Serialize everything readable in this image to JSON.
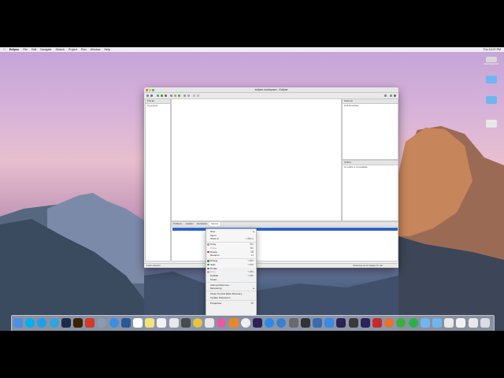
{
  "menubar": {
    "apple": "",
    "app": "Eclipse",
    "items": [
      "File",
      "Edit",
      "Navigate",
      "Search",
      "Project",
      "Run",
      "Window",
      "Help"
    ],
    "clock": "Thu 12:07 PM"
  },
  "desktop_icons": [
    {
      "label": "Macintosh HD",
      "color": "#d8d8d8"
    },
    {
      "label": "",
      "color": "#6fb6f0"
    },
    {
      "label": "",
      "color": "#6fb6f0"
    },
    {
      "label": "",
      "color": "#e8e8e8"
    }
  ],
  "window": {
    "title": "eclipse-workspace - Eclipse",
    "left_panel": {
      "tab": "Proj Ex",
      "body": "No projects"
    },
    "right_top": {
      "tab": "Task List",
      "body": "Find  All  Activate..."
    },
    "right_bottom": {
      "tab": "Outline",
      "body": "An outline is not available."
    },
    "bottom_tabs": [
      "Problems",
      "Javadoc",
      "Declaration",
      "Servers"
    ],
    "server_row": "Tomcat v8.5 Server at localhost",
    "status_left": "1 item selected",
    "status_right": "Retrieving server adapter for site"
  },
  "context_menu": {
    "items": [
      {
        "label": "New",
        "arrow": "▸",
        "shortcut": "",
        "icon": "",
        "disabled": false
      },
      {
        "label": "Open",
        "arrow": "",
        "shortcut": "",
        "icon": "",
        "disabled": false
      },
      {
        "label": "Show In",
        "arrow": "",
        "shortcut": "⌥⌘W ▸",
        "icon": "",
        "disabled": false
      },
      {
        "sep": true
      },
      {
        "label": "Copy",
        "arrow": "",
        "shortcut": "⌘C",
        "icon": "#9aa7b8",
        "disabled": false
      },
      {
        "label": "Paste",
        "arrow": "",
        "shortcut": "⌘V",
        "icon": "",
        "disabled": true
      },
      {
        "label": "Delete",
        "arrow": "",
        "shortcut": "⌫",
        "icon": "#d33",
        "disabled": false
      },
      {
        "label": "Rename",
        "arrow": "",
        "shortcut": "F2",
        "icon": "",
        "disabled": false
      },
      {
        "sep": true
      },
      {
        "label": "Debug",
        "arrow": "",
        "shortcut": "⌥⌘D",
        "icon": "#4a8a3a",
        "disabled": false
      },
      {
        "label": "Start",
        "arrow": "",
        "shortcut": "⌥⌘R",
        "icon": "#3a9a3a",
        "disabled": false
      },
      {
        "label": "Profile",
        "arrow": "",
        "shortcut": "",
        "icon": "#4a6fb0",
        "disabled": false
      },
      {
        "label": "Stop",
        "arrow": "",
        "shortcut": "⌥⌘S",
        "icon": "#c44",
        "disabled": true
      },
      {
        "label": "Publish",
        "arrow": "",
        "shortcut": "⌥⌘P",
        "icon": "",
        "disabled": false
      },
      {
        "label": "Clean...",
        "arrow": "",
        "shortcut": "",
        "icon": "",
        "disabled": false
      },
      {
        "sep": true
      },
      {
        "label": "Add and Remove...",
        "arrow": "",
        "shortcut": "",
        "icon": "",
        "disabled": false
      },
      {
        "label": "Monitoring",
        "arrow": "▸",
        "shortcut": "",
        "icon": "",
        "disabled": false
      },
      {
        "sep": true
      },
      {
        "label": "Clean Tomcat Work Directory...",
        "arrow": "",
        "shortcut": "",
        "icon": "",
        "disabled": false
      },
      {
        "label": "Update Password...",
        "arrow": "",
        "shortcut": "",
        "icon": "",
        "disabled": false
      },
      {
        "sep": true
      },
      {
        "label": "Properties",
        "arrow": "",
        "shortcut": "⌘I",
        "icon": "",
        "disabled": false
      }
    ]
  },
  "dock": {
    "apps": [
      {
        "name": "finder-icon",
        "color": "#4a90e2"
      },
      {
        "name": "skype-icon",
        "color": "#00aff0"
      },
      {
        "name": "skype-alt-icon",
        "color": "#1ea0e8"
      },
      {
        "name": "phone-icon",
        "color": "#2fa3e0"
      },
      {
        "name": "ps-icon",
        "color": "#1e2a4a"
      },
      {
        "name": "ai-icon",
        "color": "#3a2200"
      },
      {
        "name": "pdf-icon",
        "color": "#d23a2a"
      },
      {
        "name": "launchpad-icon",
        "color": "#8a9ab0"
      },
      {
        "name": "safari-icon",
        "color": "#3b8fe5"
      },
      {
        "name": "word-icon",
        "color": "#2b5797"
      },
      {
        "name": "calendar-icon",
        "color": "#ffffff"
      },
      {
        "name": "notes-icon",
        "color": "#f4e27a"
      },
      {
        "name": "reminders-icon",
        "color": "#f2f2f2"
      },
      {
        "name": "preview-icon",
        "color": "#e8e8e8"
      },
      {
        "name": "sublime-icon",
        "color": "#4a4a4a"
      },
      {
        "name": "chrome-icon",
        "color": "#e8c440"
      },
      {
        "name": "messages-icon",
        "color": "#e8e8e8"
      },
      {
        "name": "itunes-icon",
        "color": "#e85aa0"
      },
      {
        "name": "ibooks-icon",
        "color": "#e8862a"
      },
      {
        "name": "photos-icon",
        "color": "#f0f0f0"
      },
      {
        "name": "eclipse-icon",
        "color": "#2c2255"
      },
      {
        "name": "appstore-icon",
        "color": "#2a8ae8"
      },
      {
        "name": "network-icon",
        "color": "#3a7fd0"
      },
      {
        "name": "prefs-icon",
        "color": "#6a6a6a"
      },
      {
        "name": "terminal-icon",
        "color": "#333333"
      },
      {
        "name": "quicktime-icon",
        "color": "#3a6ab0"
      },
      {
        "name": "xcode-icon",
        "color": "#3a8ae8"
      },
      {
        "name": "eclipse2-icon",
        "color": "#2c2255"
      },
      {
        "name": "vmware-icon",
        "color": "#3a3a3a"
      },
      {
        "name": "eclipse3-icon",
        "color": "#2c2255"
      },
      {
        "name": "filezilla-icon",
        "color": "#c42a2a"
      },
      {
        "name": "firefox-icon",
        "color": "#e8702a"
      },
      {
        "name": "wechat-icon",
        "color": "#3ab03a"
      },
      {
        "name": "whatsapp-icon",
        "color": "#2ab04a"
      },
      {
        "name": "folder-icon",
        "color": "#6fb6f0"
      },
      {
        "name": "folder2-icon",
        "color": "#6fb6f0"
      },
      {
        "name": "screen-icon",
        "color": "#e8e8e8"
      },
      {
        "name": "doc-icon",
        "color": "#f2f2f2"
      },
      {
        "name": "downloads-icon",
        "color": "#e8e8e8"
      },
      {
        "name": "trash-icon",
        "color": "#d8dde6"
      }
    ]
  }
}
